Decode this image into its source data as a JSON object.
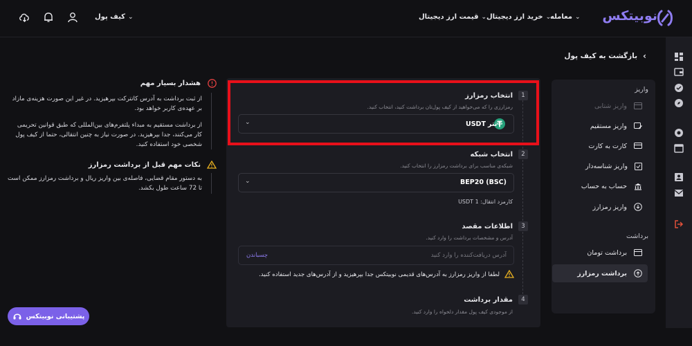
{
  "header": {
    "logo": "نوبیتکس",
    "nav": [
      {
        "label": "معامله"
      },
      {
        "label": "خرید ارز دیجیتال"
      },
      {
        "label": "قیمت ارز دیجیتال"
      }
    ],
    "wallet": "کیف پول"
  },
  "back": "بازگشت به کیف پول",
  "menu": {
    "deposit_title": "واریز",
    "deposit_items": [
      {
        "label": "واریز شتابی",
        "icon": "card-icon"
      },
      {
        "label": "واریز مستقیم",
        "icon": "card-edit-icon"
      },
      {
        "label": "کارت به کارت",
        "icon": "card-transfer-icon"
      },
      {
        "label": "واریز شناسه‌دار",
        "icon": "checklist-icon"
      },
      {
        "label": "حساب به حساب",
        "icon": "bank-icon"
      },
      {
        "label": "واریز رمزارز",
        "icon": "download-circle-icon"
      }
    ],
    "withdraw_title": "برداشت",
    "withdraw_items": [
      {
        "label": "برداشت تومان",
        "icon": "card-icon"
      },
      {
        "label": "برداشت رمزارز",
        "icon": "upload-circle-icon"
      }
    ]
  },
  "steps": [
    {
      "num": "1",
      "title": "انتخاب رمزارز",
      "sub": "رمزارزی را که می‌خواهید از کیف پول‌تان برداشت کنید، انتخاب کنید.",
      "value": "تتر",
      "code": "USDT"
    },
    {
      "num": "2",
      "title": "انتخاب شبکه",
      "sub": "شبکه‌ی مناسب برای برداشت رمزارز را انتخاب کنید.",
      "value": "BEP20 (BSC)",
      "fee": "کارمزد انتقال: 1 USDT"
    },
    {
      "num": "3",
      "title": "اطلاعات مقصد",
      "sub": "آدرس و مشخصات برداشت را وارد کنید.",
      "placeholder": "آدرس دریافت‌کننده را وارد کنید",
      "paste": "چسباندن",
      "warning": "لطفا از واریز رمزارز به آدرس‌های قدیمی نوبیتکس جدا بپرهیزید و از آدرس‌های جدید استفاده کنید."
    },
    {
      "num": "4",
      "title": "مقدار برداشت",
      "sub": "از موجودی کیف پول مقدار دلخواه را وارد کنید."
    }
  ],
  "warnings": {
    "w1_title": "هشدار بسیار مهم",
    "w1_p1a": "از ثبت برداشت به آدرس کانترکت بپرهیزید. در غیر این صورت هزینه‌ی مازاد",
    "w1_p1b": "بر عهده‌ی کاربر خواهد بود.",
    "w1_p2a": "از برداشت مستقیم به مبداء پلتفرم‌های بین‌المللی که طبق قوانین تحریمی",
    "w1_p2b": "کار می‌کنند، جدا بپرهیزید. در صورت نیاز به چنین انتقالی، حتما از کیف پول",
    "w1_p2c": "شخصی خود استفاده کنید.",
    "w2_title": "نکات مهم قبل از برداشت رمزارز",
    "w2_a": "به دستور مقام قضایی، فاصله‌ی بین واریز ریال و برداشت رمزارز ممکن است",
    "w2_b": "تا 72 ساعت طول بکشد."
  },
  "support": "پشتیبانی نوبیتکس",
  "colors": {
    "accent": "#7b61e8",
    "highlight": "#e8101a",
    "warning": "#e8b020",
    "tether": "#26a17b"
  }
}
